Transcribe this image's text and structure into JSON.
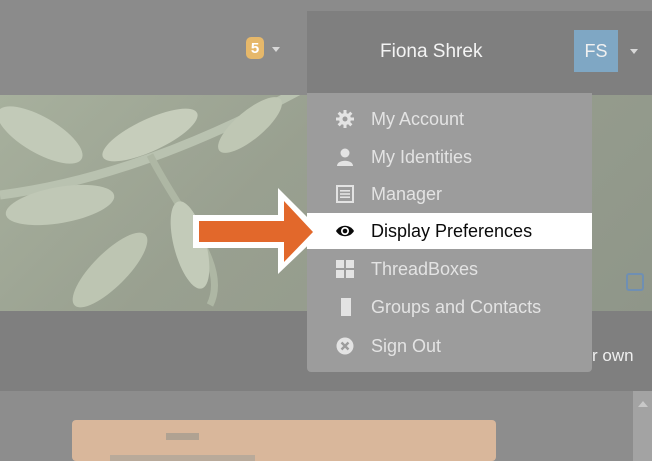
{
  "header": {
    "notification_count": "5",
    "user_name": "Fiona Shrek",
    "avatar_initials": "FS"
  },
  "banner_edit_icon": "edit-icon",
  "band": {
    "partial_text": "r own"
  },
  "menu": {
    "items": [
      {
        "label": "My Account",
        "icon": "gear-icon"
      },
      {
        "label": "My Identities",
        "icon": "user-icon"
      },
      {
        "label": "Manager",
        "icon": "list-icon"
      },
      {
        "label": "Display Preferences",
        "icon": "eye-icon"
      },
      {
        "label": "ThreadBoxes",
        "icon": "grid-icon"
      },
      {
        "label": "Groups and Contacts",
        "icon": "book-icon"
      },
      {
        "label": "Sign Out",
        "icon": "close-circle-icon"
      }
    ],
    "highlighted_index": 3
  },
  "annotation": {
    "arrow_color": "#e2682b"
  },
  "colors": {
    "badge": "#e6b86a",
    "avatar": "#7fa7c4",
    "card": "#d9b79b"
  }
}
